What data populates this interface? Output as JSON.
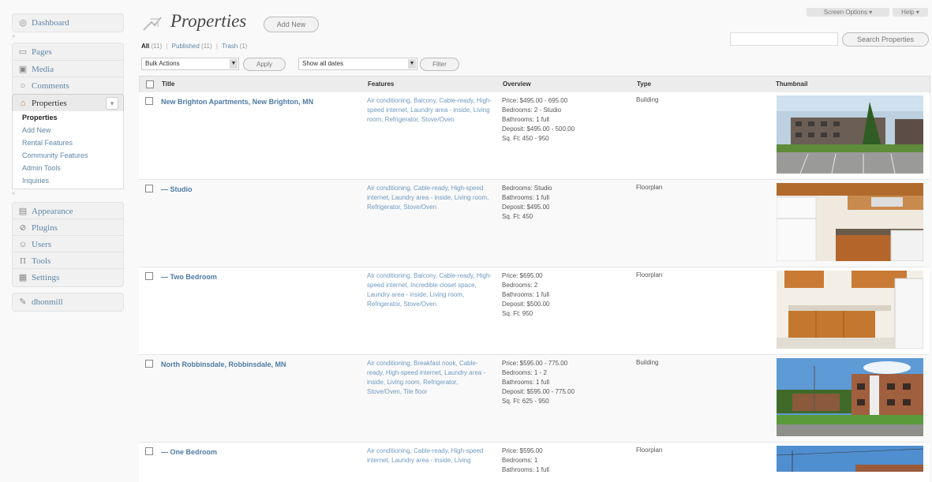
{
  "sidebar": {
    "dashboard": "Dashboard",
    "pages": "Pages",
    "media": "Media",
    "comments": "Comments",
    "properties": "Properties",
    "submenu": [
      "Properties",
      "Add New",
      "Rental Features",
      "Community Features",
      "Admin Tools",
      "Inquiries"
    ],
    "appearance": "Appearance",
    "plugins": "Plugins",
    "users": "Users",
    "tools": "Tools",
    "settings": "Settings",
    "collapse": "dhonmill"
  },
  "header": {
    "title": "Properties",
    "add_new": "Add New",
    "screen_options": "Screen Options ▾",
    "help": "Help ▾",
    "search_button": "Search Properties"
  },
  "filters": {
    "all": "All",
    "all_count": "(11)",
    "published": "Published",
    "published_count": "(11)",
    "trash": "Trash",
    "trash_count": "(1)",
    "bulk_actions": "Bulk Actions",
    "apply": "Apply",
    "dates": "Show all dates",
    "filter": "Filter"
  },
  "table": {
    "columns": {
      "title": "Title",
      "features": "Features",
      "overview": "Overview",
      "type": "Type",
      "thumbnail": "Thumbnail"
    },
    "rows": [
      {
        "title": "New Brighton Apartments, New Brighton, MN",
        "features": "Air conditioning, Balcony, Cable-ready, High-speed internet, Laundry area - inside, Living room, Refrigerator, Stove/Oven",
        "overview": [
          "Price: $495.00 - 695.00",
          "Bedrooms: 2 - Studio",
          "Bathrooms: 1 full",
          "Deposit: $495.00 - 500.00",
          "Sq. Ft: 450 - 950"
        ],
        "type": "Building",
        "thumbnail": "apartment-building-photo"
      },
      {
        "title": "— Studio",
        "features": "Air conditioning, Cable-ready, High-speed internet, Laundry area - inside, Living room, Refrigerator, Stove/Oven",
        "overview": [
          "Bedrooms: Studio",
          "Bathrooms: 1 full",
          "Deposit: $495.00",
          "Sq. Ft: 450"
        ],
        "type": "Floorplan",
        "thumbnail": "kitchen-photo"
      },
      {
        "title": "— Two Bedroom",
        "features": "Air conditioning, Balcony, Cable-ready, High-speed internet, Incredible closet space, Laundry area - inside, Living room, Refrigerator, Stove/Oven",
        "overview": [
          "Price: $695.00",
          "Bedrooms: 2",
          "Bathrooms: 1 full",
          "Deposit: $500.00",
          "Sq. Ft: 950"
        ],
        "type": "Floorplan",
        "thumbnail": "kitchen-photo"
      },
      {
        "title": "North Robbinsdale, Robbinsdale, MN",
        "features": "Air conditioning, Breakfast nook, Cable-ready, High-speed internet, Laundry area - inside, Living room, Refrigerator, Stove/Oven, Tile floor",
        "overview": [
          "Price: $595.00 - 775.00",
          "Bedrooms: 1 - 2",
          "Bathrooms: 1 full",
          "Deposit: $595.00 - 775.00",
          "Sq. Ft: 625 - 950"
        ],
        "type": "Building",
        "thumbnail": "brick-building-photo"
      },
      {
        "title": "— One Bedroom",
        "features": "Air conditioning, Cable-ready, High-speed internet, Laundry area - inside, Living",
        "overview": [
          "Price: $595.00",
          "Bedrooms: 1",
          "Bathrooms: 1 full"
        ],
        "type": "Floorplan",
        "thumbnail": "brick-building-photo"
      }
    ]
  },
  "colors": {
    "link": "#4d7ba3",
    "feature_link": "#6f9ac0",
    "header_bg": "#ececec"
  }
}
